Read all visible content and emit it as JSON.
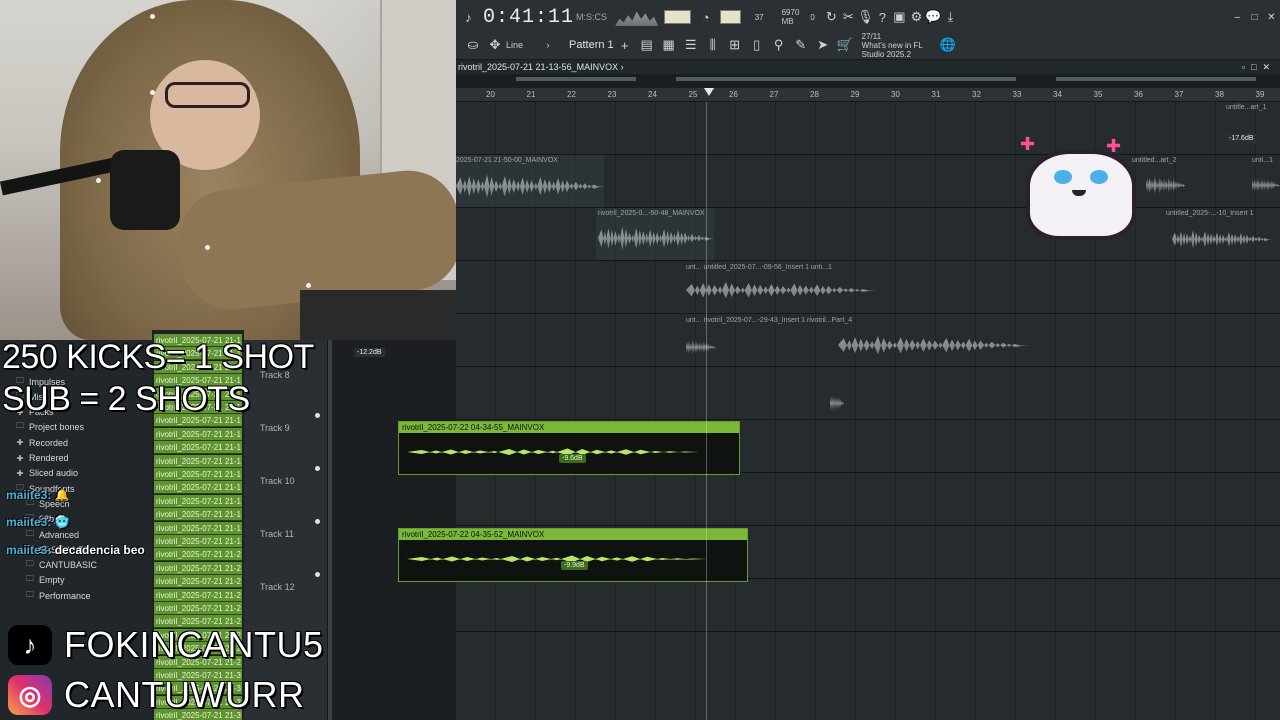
{
  "header": {
    "clock": "0:41:11",
    "clock_unit": "M:S:CS",
    "tempo_small": "37",
    "memory": "6970 MB",
    "voices": "0",
    "snap": "Line",
    "pattern": "Pattern 1",
    "news_count": "27/11",
    "news_title": "What's new in FL",
    "news_sub": "Studio 2025.2"
  },
  "playlist": {
    "title": "rivotril_2025-07-21 21-13-56_MAINVOX",
    "bars": [
      "20",
      "21",
      "22",
      "23",
      "24",
      "25",
      "26",
      "27",
      "28",
      "29",
      "30",
      "31",
      "32",
      "33",
      "34",
      "35",
      "36",
      "37",
      "38",
      "39"
    ]
  },
  "clips_upper": [
    {
      "label": "2025-07-21 21-50-00_MAINVOX"
    },
    {
      "label": "rivotril_2025-0...-50-48_MAINVOX"
    },
    {
      "label": "unt...   untitled_2025-07...-09-56_Insert 1   unti...1"
    },
    {
      "label": "unt...                 rivotril_2025-07...-29-43_Insert 1   rivotril...Part_4"
    },
    {
      "label": "untitle...art_1"
    },
    {
      "label": "untitled...art_2"
    },
    {
      "label": "unti...1"
    },
    {
      "label": "untitled_2025-...-10_Insert 1"
    }
  ],
  "db_tags": {
    "upper_right": "-17.6dB",
    "left": "-12.2dB"
  },
  "tracks": [
    {
      "name": "Track 8"
    },
    {
      "name": "Track 9"
    },
    {
      "name": "Track 10"
    },
    {
      "name": "Track 11"
    },
    {
      "name": "Track 12"
    }
  ],
  "green_clips": [
    {
      "label": "rivotril_2025-07-22 04-34-55_MAINVOX",
      "db": "-9.6dB"
    },
    {
      "label": "rivotril_2025-07-22 04-35-52_MAINVOX",
      "db": "-9.9dB"
    }
  ],
  "browser": {
    "items": [
      {
        "icon": "folder",
        "label": "Impulses"
      },
      {
        "icon": "folder",
        "label": "Mis"
      },
      {
        "icon": "pack",
        "label": "Packs"
      },
      {
        "icon": "folder",
        "label": "Project bones"
      },
      {
        "icon": "plus",
        "label": "Recorded"
      },
      {
        "icon": "plus",
        "label": "Rendered"
      },
      {
        "icon": "plus",
        "label": "Sliced audio"
      },
      {
        "icon": "folder",
        "label": "Soundfonts"
      },
      {
        "icon": "folder",
        "label": "Speech"
      },
      {
        "icon": "folder",
        "label": "98bpm"
      },
      {
        "icon": "folder",
        "label": "Advanced"
      },
      {
        "icon": "folder",
        "label": "BASICANTÚ"
      },
      {
        "icon": "folder",
        "label": "CANTUBASIC"
      },
      {
        "icon": "folder",
        "label": "Empty"
      },
      {
        "icon": "folder",
        "label": "Performance"
      }
    ],
    "files": [
      "rivotril_2025-07-21 21-1",
      "rivotril_2025-07-21 21-1",
      "rivotril_2025-07-21 21-1",
      "rivotril_2025-07-21 21-1",
      "rivotril_2025-07-21 21-1",
      "rivotril_2025-07-21 21-1",
      "rivotril_2025-07-21 21-1",
      "rivotril_2025-07-21 21-1",
      "rivotril_2025-07-21 21-1",
      "rivotril_2025-07-21 21-1",
      "rivotril_2025-07-21 21-1",
      "rivotril_2025-07-21 21-1",
      "rivotril_2025-07-21 21-1",
      "rivotril_2025-07-21 21-1",
      "rivotril_2025-07-21 21-1",
      "rivotril_2025-07-21 21-1",
      "rivotril_2025-07-21 21-2",
      "rivotril_2025-07-21 21-2",
      "rivotril_2025-07-21 21-2",
      "rivotril_2025-07-21 21-2",
      "rivotril_2025-07-21 21-2",
      "rivotril_2025-07-21 21-2",
      "rivotril_2025-07-21 21-2",
      "rivotril_2025-07-21 21-2",
      "rivotril_2025-07-21 21-2",
      "rivotril_2025-07-21 21-3",
      "rivotril_2025-07-21 21-3",
      "rivotril_2025-07-21 21-3",
      "rivotril_2025-07-21 21-3"
    ]
  },
  "overlay": {
    "line1": "250 KICKS= 1 SHOT",
    "line2": "SUB = 2 SHOTS"
  },
  "chat": [
    {
      "user": "maiite3:",
      "text": "🔔"
    },
    {
      "user": "maiite3:",
      "text": "🥶"
    },
    {
      "user": "maiite3:",
      "text": "decadencia beo"
    }
  ],
  "socials": {
    "tiktok": "FOKINCANTU5",
    "instagram": "CANTUWURR"
  },
  "colors": {
    "green_clip": "#7bb83a",
    "chat_user": "#4fb0d8"
  }
}
